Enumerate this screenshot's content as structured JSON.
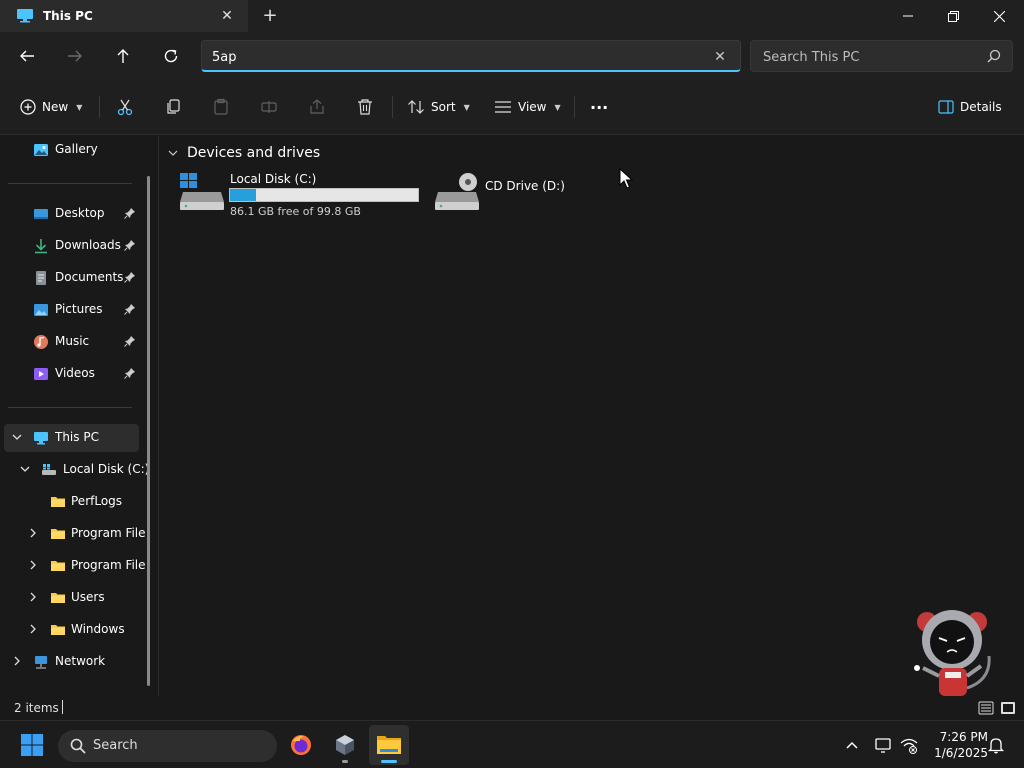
{
  "window": {
    "tab_title": "This PC",
    "tab_close": "✕",
    "new_tab": "+"
  },
  "address": {
    "value": "5ap",
    "clear": "✕"
  },
  "search": {
    "placeholder": "Search This PC"
  },
  "commands": {
    "new_label": "New",
    "sort_label": "Sort",
    "view_label": "View",
    "more_label": "···",
    "details_label": "Details"
  },
  "sidebar": {
    "gallery": "Gallery",
    "quick_access": [
      {
        "label": "Desktop"
      },
      {
        "label": "Downloads"
      },
      {
        "label": "Documents"
      },
      {
        "label": "Pictures"
      },
      {
        "label": "Music"
      },
      {
        "label": "Videos"
      }
    ],
    "this_pc": "This PC",
    "local_disk": "Local Disk (C:)",
    "folders": [
      {
        "label": "PerfLogs"
      },
      {
        "label": "Program File"
      },
      {
        "label": "Program File"
      },
      {
        "label": "Users"
      },
      {
        "label": "Windows"
      }
    ],
    "network": "Network"
  },
  "main": {
    "group_title": "Devices and drives",
    "drives": [
      {
        "name": "Local Disk (C:)",
        "free_text": "86.1 GB free of 99.8 GB",
        "used_fraction": 0.137
      },
      {
        "name": "CD Drive (D:)"
      }
    ]
  },
  "status": {
    "items": "2 items"
  },
  "taskbar": {
    "search_label": "Search",
    "time": "7:26 PM",
    "date": "1/6/2025"
  },
  "colors": {
    "accent": "#4cc2ff",
    "folder": "#f8c94a",
    "bar_fill": "#26a0da"
  }
}
